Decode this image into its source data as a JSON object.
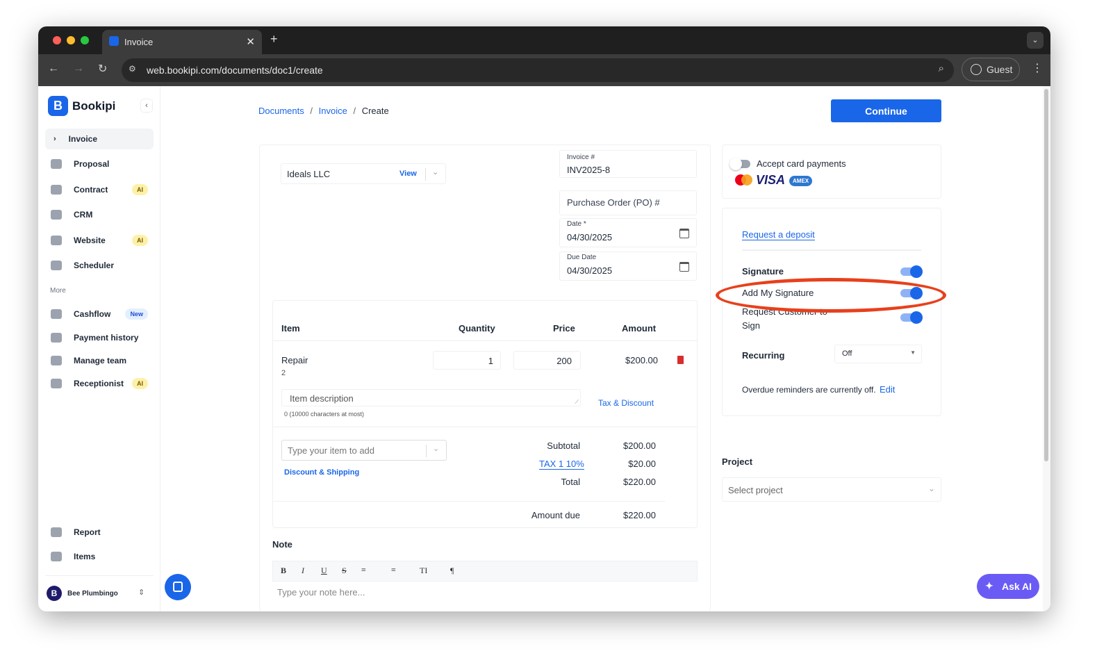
{
  "browser": {
    "tab_title": "Invoice",
    "url": "web.bookipi.com/documents/doc1/create",
    "profile": "Guest"
  },
  "sidebar": {
    "brand": "Bookipi",
    "items": [
      {
        "label": "Invoice"
      },
      {
        "label": "Proposal"
      },
      {
        "label": "Contract",
        "badge": "AI"
      },
      {
        "label": "CRM"
      },
      {
        "label": "Website",
        "badge": "AI"
      },
      {
        "label": "Scheduler"
      }
    ],
    "more_label": "More",
    "more_items": [
      {
        "label": "Cashflow",
        "badge": "New"
      },
      {
        "label": "Payment history"
      },
      {
        "label": "Manage team"
      },
      {
        "label": "Receptionist",
        "badge": "AI"
      }
    ],
    "bottom_items": [
      {
        "label": "Report"
      },
      {
        "label": "Items"
      }
    ],
    "account": "Bee Plumbingo"
  },
  "breadcrumb": {
    "documents": "Documents",
    "invoice": "Invoice",
    "current": "Create",
    "sep": "/"
  },
  "continue_label": "Continue",
  "client": {
    "name": "Ideals LLC",
    "view": "View"
  },
  "meta": {
    "invoice_label": "Invoice #",
    "invoice_no": "INV2025-8",
    "po_placeholder": "Purchase Order (PO) #",
    "date_label": "Date *",
    "date": "04/30/2025",
    "due_label": "Due Date",
    "due": "04/30/2025"
  },
  "items_table": {
    "headers": [
      "Item",
      "Quantity",
      "Price",
      "Amount"
    ],
    "rows": [
      {
        "name": "Repair",
        "sub": "2",
        "qty": "1",
        "price": "200",
        "amount": "$200.00"
      }
    ],
    "desc_placeholder": "Item description",
    "desc_count": "0 (10000 characters at most)",
    "tax_discount": "Tax & Discount",
    "add_placeholder": "Type your item to add",
    "discount_shipping": "Discount & Shipping"
  },
  "totals": {
    "subtotal_label": "Subtotal",
    "subtotal": "$200.00",
    "tax_label": "TAX 1 10%",
    "tax": "$20.00",
    "total_label": "Total",
    "total": "$220.00",
    "due_label": "Amount due",
    "due": "$220.00"
  },
  "note": {
    "label": "Note",
    "placeholder": "Type your note here...",
    "tools": [
      "B",
      "I",
      "U",
      "S",
      "≡",
      "≡",
      "TI",
      "¶"
    ]
  },
  "payments": {
    "accept_label": "Accept card payments",
    "accept_on": false,
    "visa": "VISA",
    "amex": "AMEX"
  },
  "options": {
    "deposit": "Request a deposit",
    "signature": "Signature",
    "signature_on": true,
    "add_sig": "Add My Signature",
    "add_sig_on": true,
    "request_sign": "Request Customer to Sign",
    "request_sign_on": true,
    "recurring_label": "Recurring",
    "recurring_value": "Off",
    "reminders": "Overdue reminders are currently off.",
    "edit": "Edit"
  },
  "project": {
    "label": "Project",
    "placeholder": "Select project"
  },
  "ask_ai": "Ask AI",
  "colors": {
    "accent": "#1a66e8",
    "annotation": "#e8401c"
  }
}
